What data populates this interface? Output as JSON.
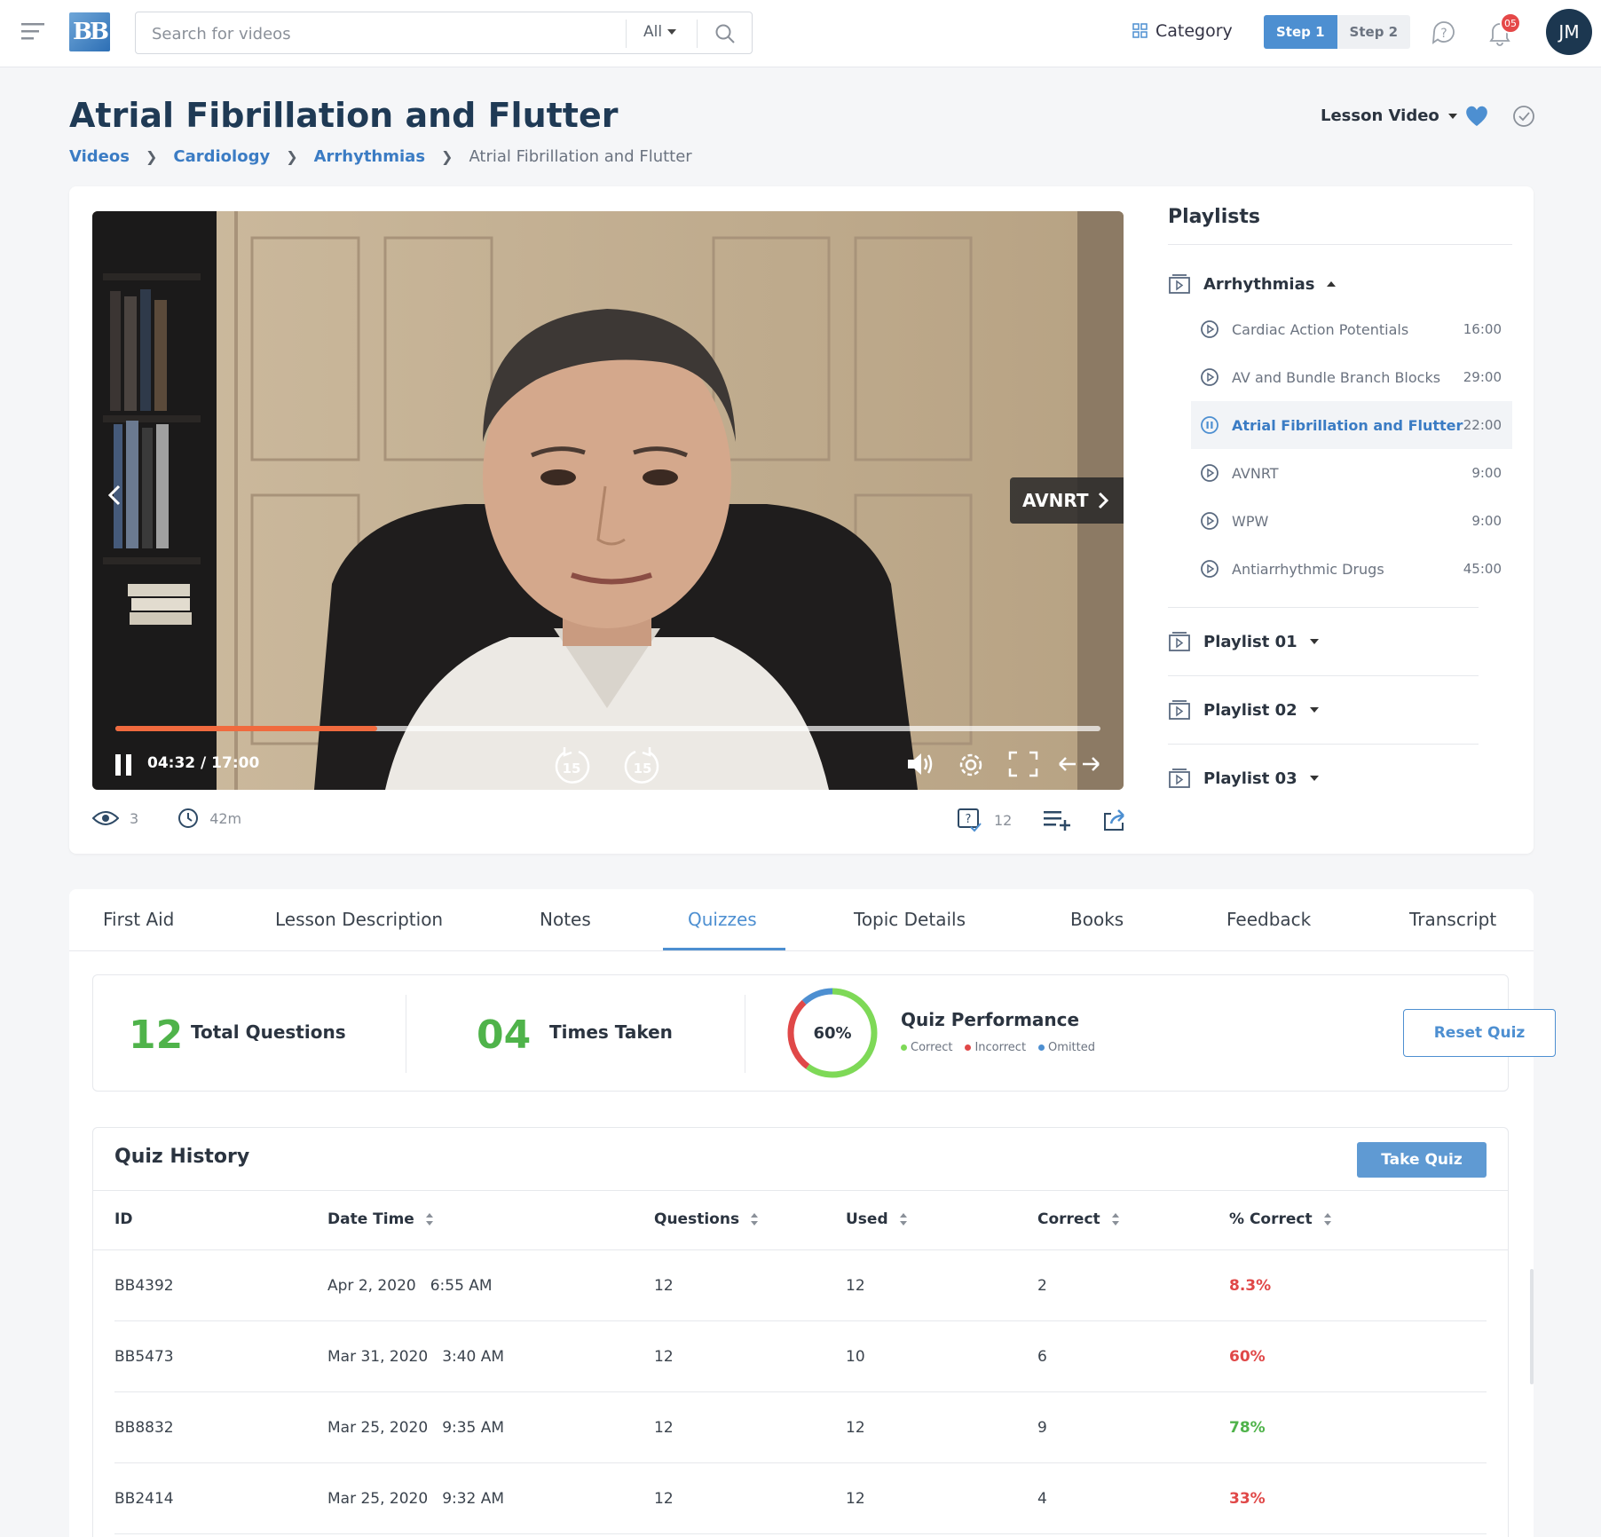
{
  "header": {
    "logo_text": "BB",
    "search_placeholder": "Search for videos",
    "search_scope": "All",
    "category_label": "Category",
    "steps": [
      "Step 1",
      "Step 2"
    ],
    "notification_count": "05",
    "avatar_initials": "JM"
  },
  "page": {
    "title": "Atrial Fibrillation and Flutter",
    "breadcrumb": [
      "Videos",
      "Cardiology",
      "Arrhythmias",
      "Atrial Fibrillation and Flutter"
    ],
    "view_selector": "Lesson Video"
  },
  "player": {
    "next_label": "AVNRT",
    "time": "04:32 / 17:00",
    "progress": 0.266,
    "skip_seconds": "15",
    "views": "3",
    "duration": "42m",
    "question_count": "12"
  },
  "playlists": {
    "title": "Playlists",
    "open_group": "Arrhythmias",
    "items": [
      {
        "title": "Cardiac Action Potentials",
        "duration": "16:00",
        "active": false
      },
      {
        "title": "AV and Bundle Branch Blocks",
        "duration": "29:00",
        "active": false
      },
      {
        "title": "Atrial Fibrillation and Flutter",
        "duration": "22:00",
        "active": true
      },
      {
        "title": "AVNRT",
        "duration": "9:00",
        "active": false
      },
      {
        "title": "WPW",
        "duration": "9:00",
        "active": false
      },
      {
        "title": "Antiarrhythmic Drugs",
        "duration": "45:00",
        "active": false
      }
    ],
    "other_groups": [
      "Playlist 01",
      "Playlist 02",
      "Playlist 03"
    ]
  },
  "tabs": [
    "First Aid",
    "Lesson Description",
    "Notes",
    "Quizzes",
    "Topic Details",
    "Books",
    "Feedback",
    "Transcript"
  ],
  "active_tab": "Quizzes",
  "quiz_stats": {
    "total_questions": "12",
    "total_questions_label": "Total Questions",
    "times_taken": "04",
    "times_taken_label": "Times Taken",
    "performance_percent": "60%",
    "performance_value": 60,
    "performance_title": "Quiz Performance",
    "legend": [
      {
        "label": "Correct",
        "color": "#7ed957"
      },
      {
        "label": "Incorrect",
        "color": "#e04848"
      },
      {
        "label": "Omitted",
        "color": "#4d8fd1"
      }
    ],
    "reset_label": "Reset Quiz"
  },
  "history": {
    "title": "Quiz History",
    "take_label": "Take Quiz",
    "columns": [
      "ID",
      "Date Time",
      "Questions",
      "Used",
      "Correct",
      "% Correct"
    ],
    "rows": [
      {
        "id": "BB4392",
        "date": "Apr 2, 2020",
        "time": "6:55 AM",
        "questions": "12",
        "used": "12",
        "correct": "2",
        "pct": "8.3%",
        "status": "low"
      },
      {
        "id": "BB5473",
        "date": "Mar 31, 2020",
        "time": "3:40 AM",
        "questions": "12",
        "used": "10",
        "correct": "6",
        "pct": "60%",
        "status": "low"
      },
      {
        "id": "BB8832",
        "date": "Mar 25, 2020",
        "time": "9:35 AM",
        "questions": "12",
        "used": "12",
        "correct": "9",
        "pct": "78%",
        "status": "high"
      },
      {
        "id": "BB2414",
        "date": "Mar 25, 2020",
        "time": "9:32 AM",
        "questions": "12",
        "used": "12",
        "correct": "4",
        "pct": "33%",
        "status": "low"
      }
    ]
  },
  "colors": {
    "accent": "#4d8fd1",
    "good": "#4fb34a",
    "bad": "#e04848"
  }
}
